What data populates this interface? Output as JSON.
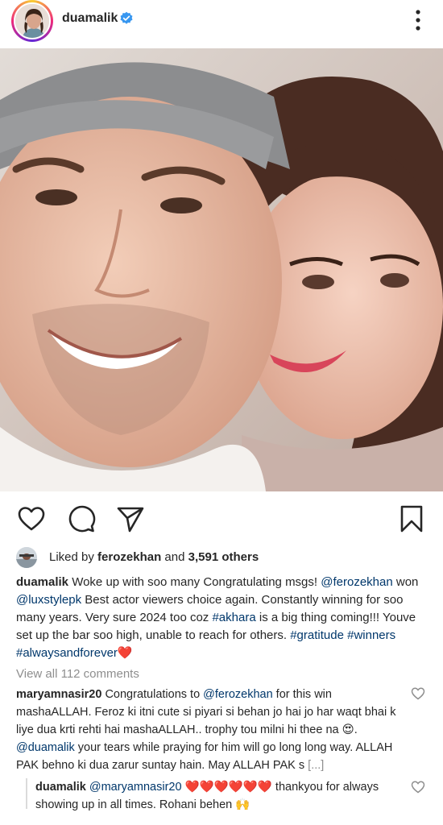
{
  "post": {
    "username": "duamalik",
    "verified_icon": "verified-badge-icon",
    "more_icon": "more-vertical-icon"
  },
  "actions": {
    "like_icon": "heart-icon",
    "comment_icon": "comment-icon",
    "share_icon": "send-icon",
    "save_icon": "bookmark-icon"
  },
  "likes": {
    "prefix": "Liked by ",
    "user": "ferozekhan",
    "and": " and ",
    "others": "3,591 others"
  },
  "caption": {
    "username": "duamalik",
    "t1": " Woke up with soo many Congratulating msgs! ",
    "m1": "@ferozekhan",
    "t2": " won ",
    "m2": "@luxstylepk",
    "t3": " Best actor viewers choice again. Constantly winning for soo many years. Very sure 2024 too coz ",
    "h1": "#akhara",
    "t4": " is a big thing coming!!! Youve set up the bar soo high, unable to reach for others. ",
    "h2": "#gratitude",
    "t5": " ",
    "h3": "#winners",
    "t6": " ",
    "h4": "#alwaysandforever",
    "t7": "❤️"
  },
  "view_all": "View all 112 comments",
  "comment1": {
    "username": "maryamnasir20",
    "t1": " Congratulations to ",
    "m1": "@ferozekhan",
    "t2": " for this win mashaALLAH. Feroz ki itni cute si piyari si behan jo hai jo har waqt bhai k liye dua krti rehti hai mashaALLAH.. trophy tou milni hi thee na 😍. ",
    "m2": "@duamalik",
    "t3": "  your tears while praying for him will go long long way. ALLAH PAK behno ki dua zarur suntay hain.  May ALLAH PAK s ",
    "more": "[...]"
  },
  "comment2": {
    "username": "duamalik",
    "m1": " @maryamnasir20",
    "t1": " ❤️❤️❤️❤️❤️❤️ thankyou for always showing up in all times. Rohani behen 🙌"
  }
}
